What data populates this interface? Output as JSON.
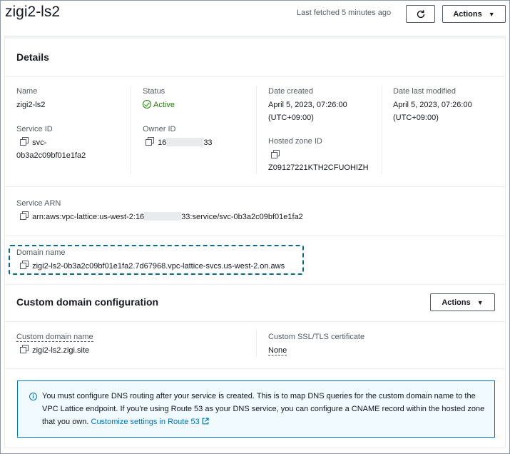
{
  "header": {
    "title": "zigi2-ls2",
    "last_fetched": "Last fetched 5 minutes ago",
    "actions_label": "Actions"
  },
  "details": {
    "title": "Details",
    "name_label": "Name",
    "name_value": "zigi2-ls2",
    "status_label": "Status",
    "status_value": "Active",
    "date_created_label": "Date created",
    "date_created_value": "April 5, 2023, 07:26:00",
    "date_created_tz": "(UTC+09:00)",
    "date_modified_label": "Date last modified",
    "date_modified_value": "April 5, 2023, 07:26:00",
    "date_modified_tz": "(UTC+09:00)",
    "service_id_label": "Service ID",
    "service_id_line1": "svc-",
    "service_id_line2": "0b3a2c09bf01e1fa2",
    "owner_id_label": "Owner ID",
    "owner_id_prefix": "16",
    "owner_id_suffix": "33",
    "hosted_zone_label": "Hosted zone ID",
    "hosted_zone_value": "Z09127221KTH2CFUOHIZH",
    "service_arn_label": "Service ARN",
    "service_arn_prefix": "arn:aws:vpc-lattice:us-west-2:16",
    "service_arn_suffix": "33:service/svc-0b3a2c09bf01e1fa2",
    "domain_name_label": "Domain name",
    "domain_name_value": "zigi2-ls2-0b3a2c09bf01e1fa2.7d67968.vpc-lattice-svcs.us-west-2.on.aws"
  },
  "custom_domain": {
    "title": "Custom domain configuration",
    "actions_label": "Actions",
    "domain_name_label": "Custom domain name",
    "domain_name_value": "zigi2-ls2.zigi.site",
    "cert_label": "Custom SSL/TLS certificate",
    "cert_value": "None"
  },
  "alert": {
    "text": "You must configure DNS routing after your service is created. This is to map DNS queries for the custom domain name to the VPC Lattice endpoint. If you're using Route 53 as your DNS service, you can configure a CNAME record within the hosted zone that you own.",
    "link_text": "Customize settings in Route 53"
  },
  "colors": {
    "active": "#1d8102",
    "link": "#0073bb",
    "focus": "#0b6a8a"
  }
}
